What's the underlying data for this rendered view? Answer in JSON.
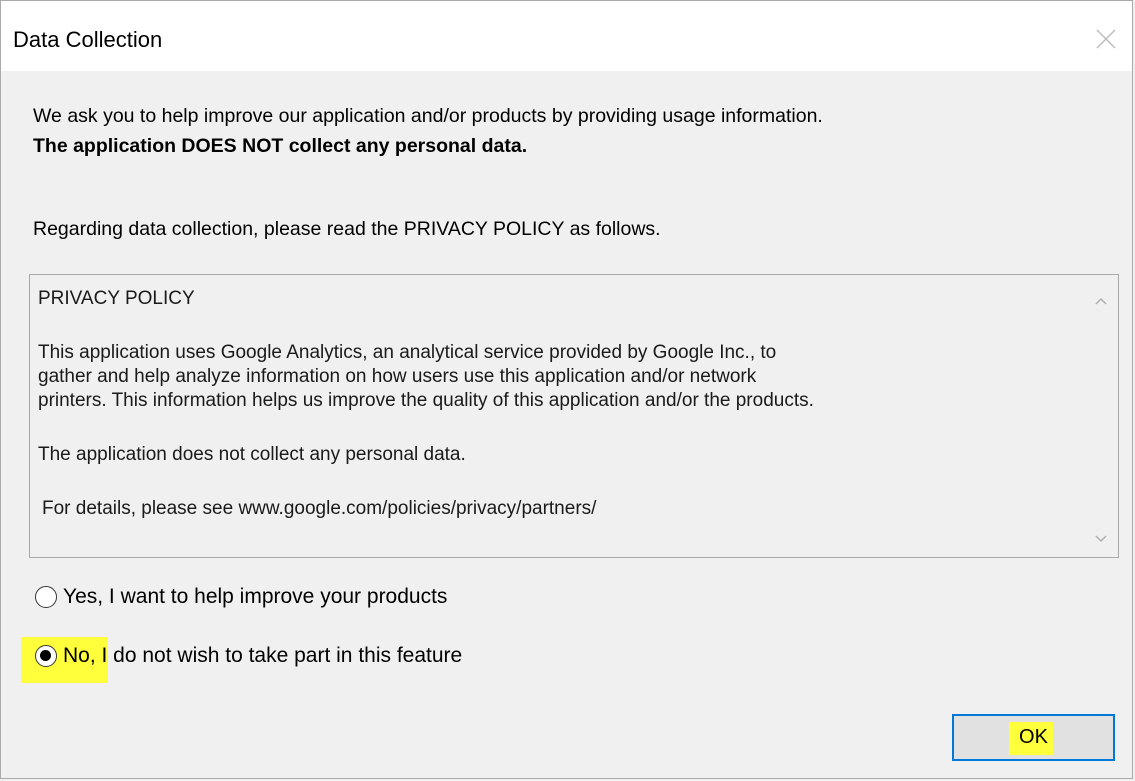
{
  "window": {
    "title": "Data Collection",
    "close_icon": "close-icon"
  },
  "intro": {
    "line1": "We ask you to help improve our application and/or products by providing usage information.",
    "line2": "The application DOES NOT collect any personal data."
  },
  "regarding": "Regarding data collection, please read the PRIVACY POLICY as follows.",
  "policy": {
    "heading": "PRIVACY POLICY",
    "para1_line1": "This application uses Google Analytics, an analytical service provided by Google Inc., to",
    "para1_line2": "gather and help analyze information on how users use this application and/or network",
    "para1_line3": "printers. This information helps us improve the quality of this application and/or the products.",
    "para2": "The application does not collect any personal data.",
    "para3": "For details, please see www.google.com/policies/privacy/partners/"
  },
  "options": {
    "yes_label": "Yes, I want to help improve your products",
    "no_label": "No, I do not wish to take part in this feature",
    "selected": "no"
  },
  "buttons": {
    "ok_label": "OK"
  },
  "colors": {
    "highlight": "#ffff3c",
    "button_border": "#0078d7",
    "window_bg": "#f0f0f0"
  }
}
